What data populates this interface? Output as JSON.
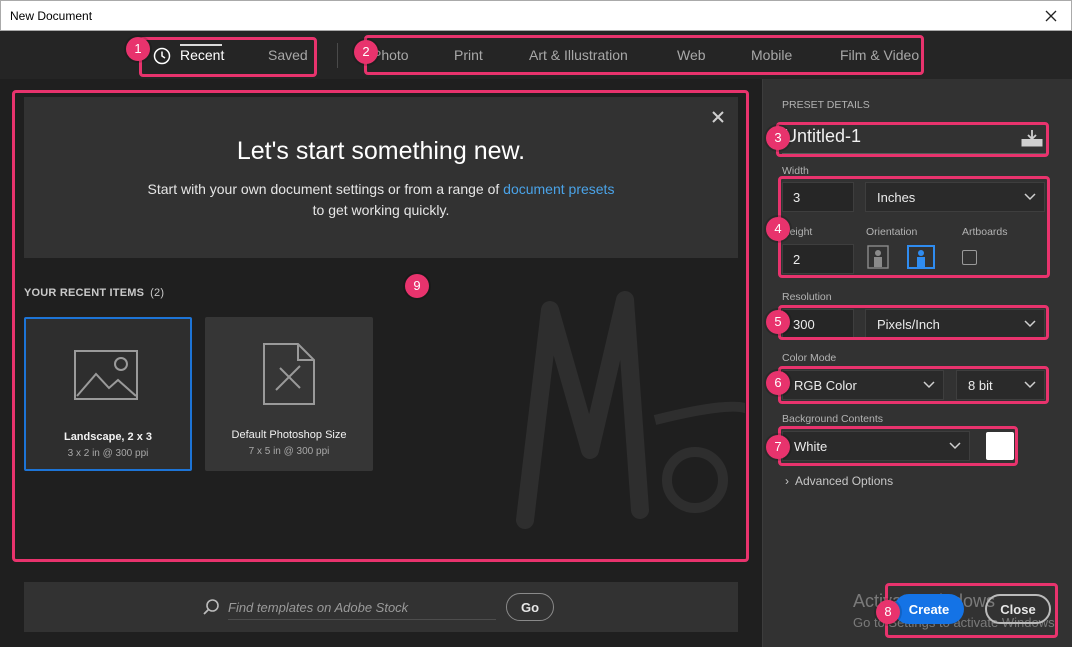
{
  "window": {
    "title": "New Document"
  },
  "tabs": {
    "recent": "Recent",
    "saved": "Saved",
    "categories": [
      "Photo",
      "Print",
      "Art & Illustration",
      "Web",
      "Mobile",
      "Film & Video"
    ]
  },
  "welcome": {
    "headline": "Let's start something new.",
    "line1_prefix": "Start with your own document settings or from a range of ",
    "line1_link": "document presets",
    "line2": "to get working quickly."
  },
  "recent_items": {
    "label": "YOUR RECENT ITEMS",
    "count": "(2)",
    "items": [
      {
        "name": "Landscape, 2 x 3",
        "meta": "3 x 2 in @ 300 ppi"
      },
      {
        "name": "Default Photoshop Size",
        "meta": "7 x 5 in @ 300 ppi"
      }
    ]
  },
  "search": {
    "placeholder": "Find templates on Adobe Stock",
    "go_label": "Go"
  },
  "preset": {
    "section_label": "PRESET DETAILS",
    "name": "Untitled-1",
    "width_label": "Width",
    "width_value": "3",
    "width_unit": "Inches",
    "height_label": "Height",
    "height_value": "2",
    "orientation_label": "Orientation",
    "artboards_label": "Artboards",
    "resolution_label": "Resolution",
    "resolution_value": "300",
    "resolution_unit": "Pixels/Inch",
    "color_mode_label": "Color Mode",
    "color_mode": "RGB Color",
    "bit_depth": "8 bit",
    "background_label": "Background Contents",
    "background": "White",
    "background_swatch": "#ffffff",
    "advanced_label": "Advanced Options"
  },
  "actions": {
    "create": "Create",
    "close": "Close"
  },
  "watermark": {
    "line1": "Activate Windows",
    "line2": "Go to Settings to activate Windows."
  },
  "annotations": [
    "1",
    "2",
    "3",
    "4",
    "5",
    "6",
    "7",
    "8",
    "9"
  ],
  "colors": {
    "accent": "#1473e6",
    "annotation": "#e8336d",
    "link": "#4aa3e8"
  }
}
